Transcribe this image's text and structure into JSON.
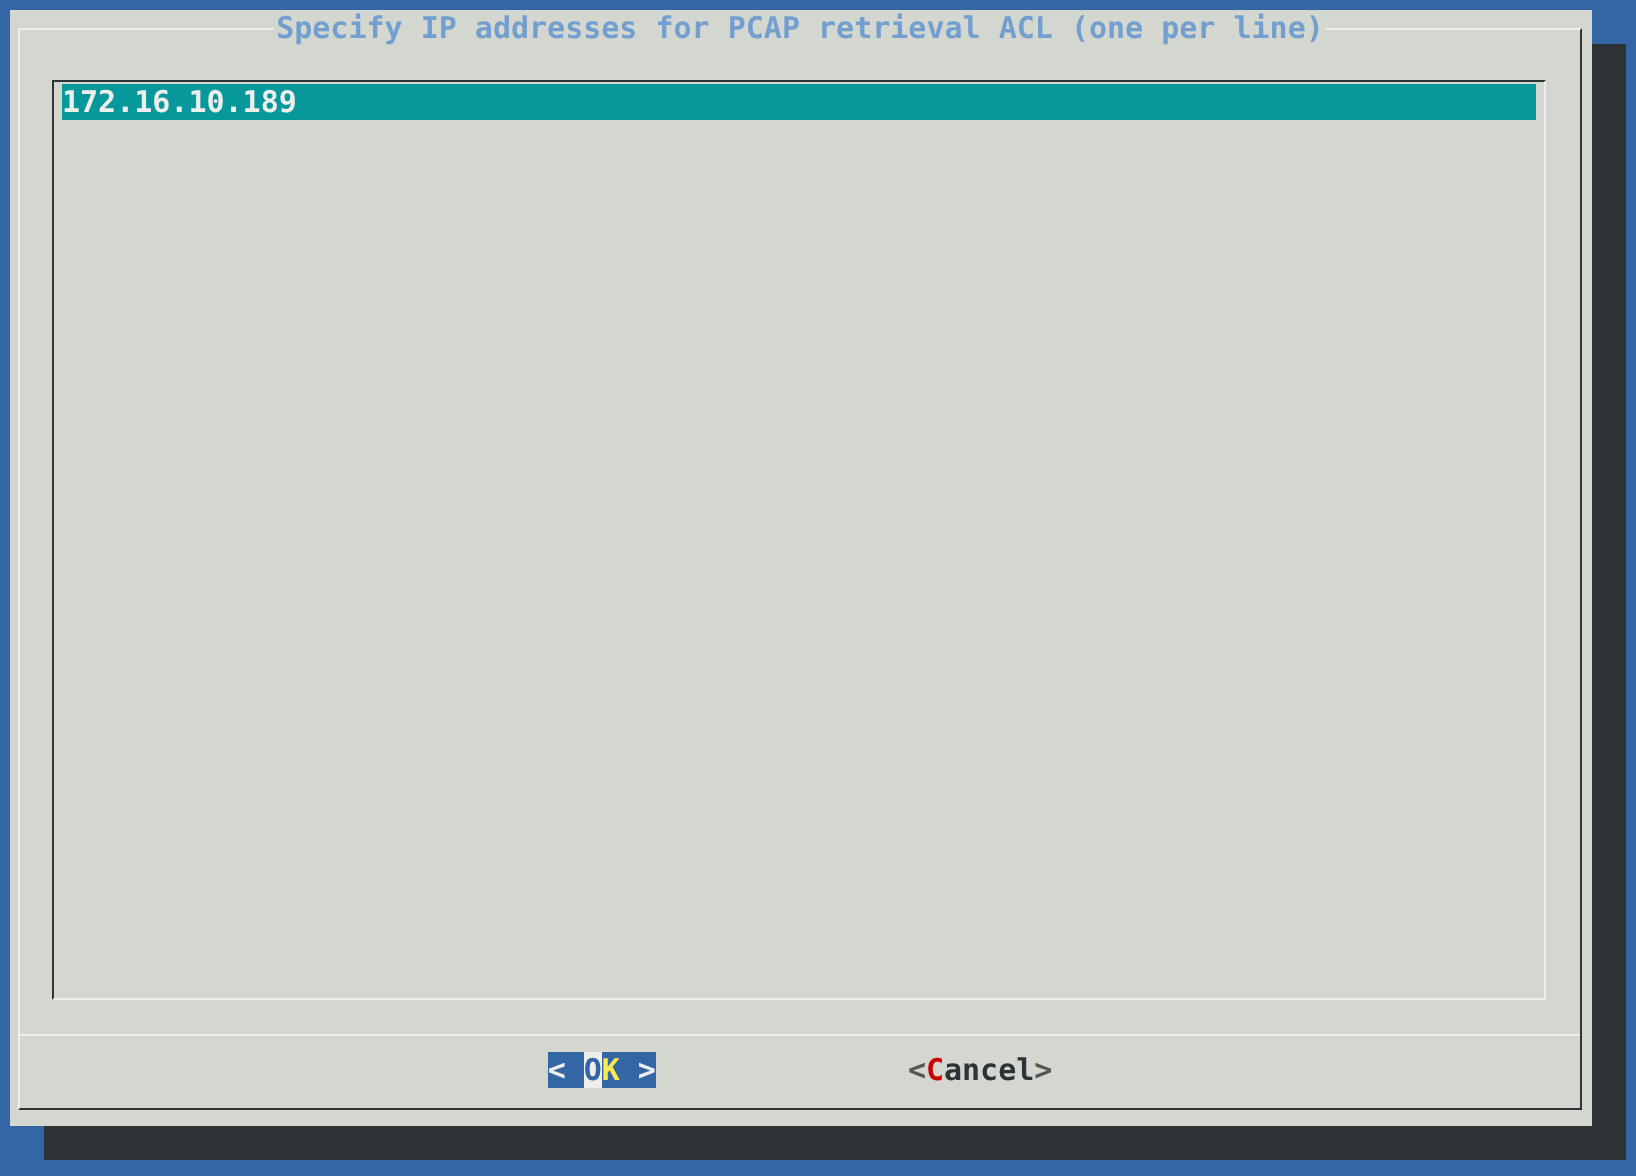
{
  "dialog": {
    "title": "Specify IP addresses for PCAP retrieval ACL (one per line)",
    "lines": [
      {
        "text": "172.16.10.189",
        "selected": true
      }
    ],
    "buttons": [
      {
        "open": "<",
        "first": "O",
        "rest": "K",
        "close": ">",
        "selected": true
      },
      {
        "open": "<",
        "first": "C",
        "rest": "ancel",
        "close": ">",
        "selected": false
      }
    ]
  }
}
